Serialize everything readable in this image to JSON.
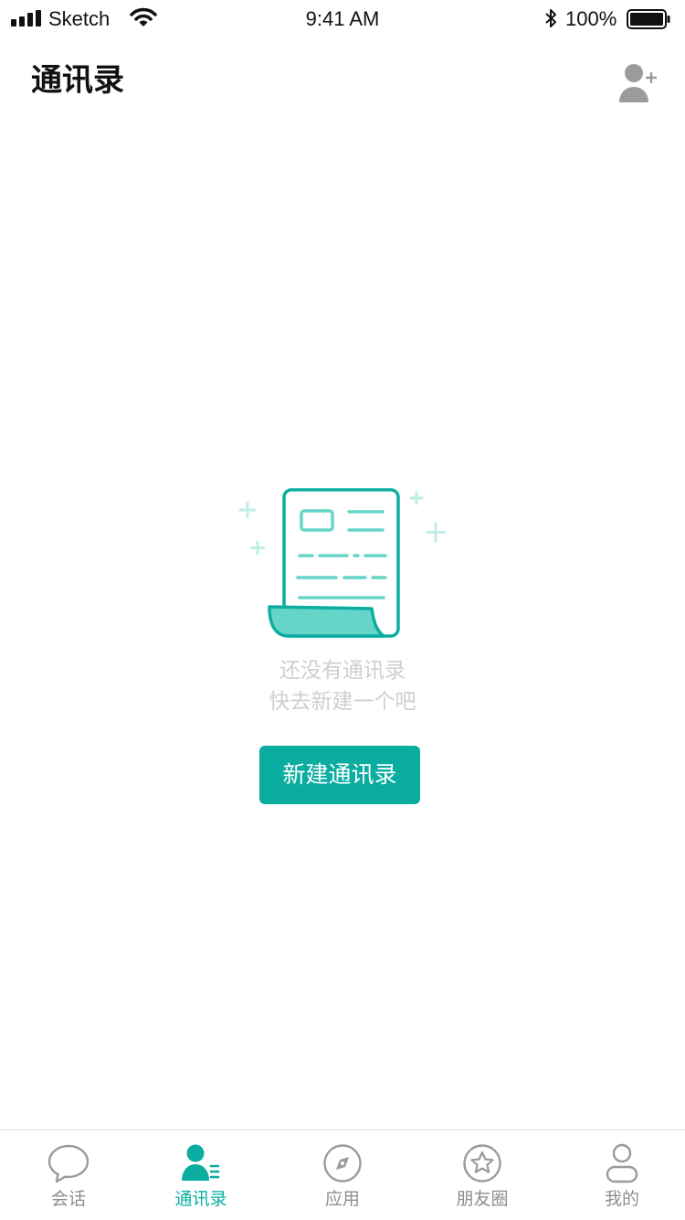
{
  "status_bar": {
    "carrier": "Sketch",
    "time": "9:41 AM",
    "battery": "100%"
  },
  "header": {
    "title": "通讯录",
    "add_icon": "add-contact-icon"
  },
  "empty_state": {
    "icon": "contacts-document-icon",
    "line1": "还没有通讯录",
    "line2": "快去新建一个吧",
    "button_label": "新建通讯录"
  },
  "tab_bar": {
    "tabs": [
      {
        "label": "会话",
        "icon": "chat-bubble-icon",
        "active": false
      },
      {
        "label": "通讯录",
        "icon": "contacts-icon",
        "active": true
      },
      {
        "label": "应用",
        "icon": "compass-icon",
        "active": false
      },
      {
        "label": "朋友圈",
        "icon": "star-icon",
        "active": false
      },
      {
        "label": "我的",
        "icon": "profile-icon",
        "active": false
      }
    ]
  },
  "colors": {
    "accent": "#0aada0",
    "accent_light": "#66d5c9",
    "inactive": "#8e8e8e",
    "placeholder_text": "#cfcfcf"
  }
}
